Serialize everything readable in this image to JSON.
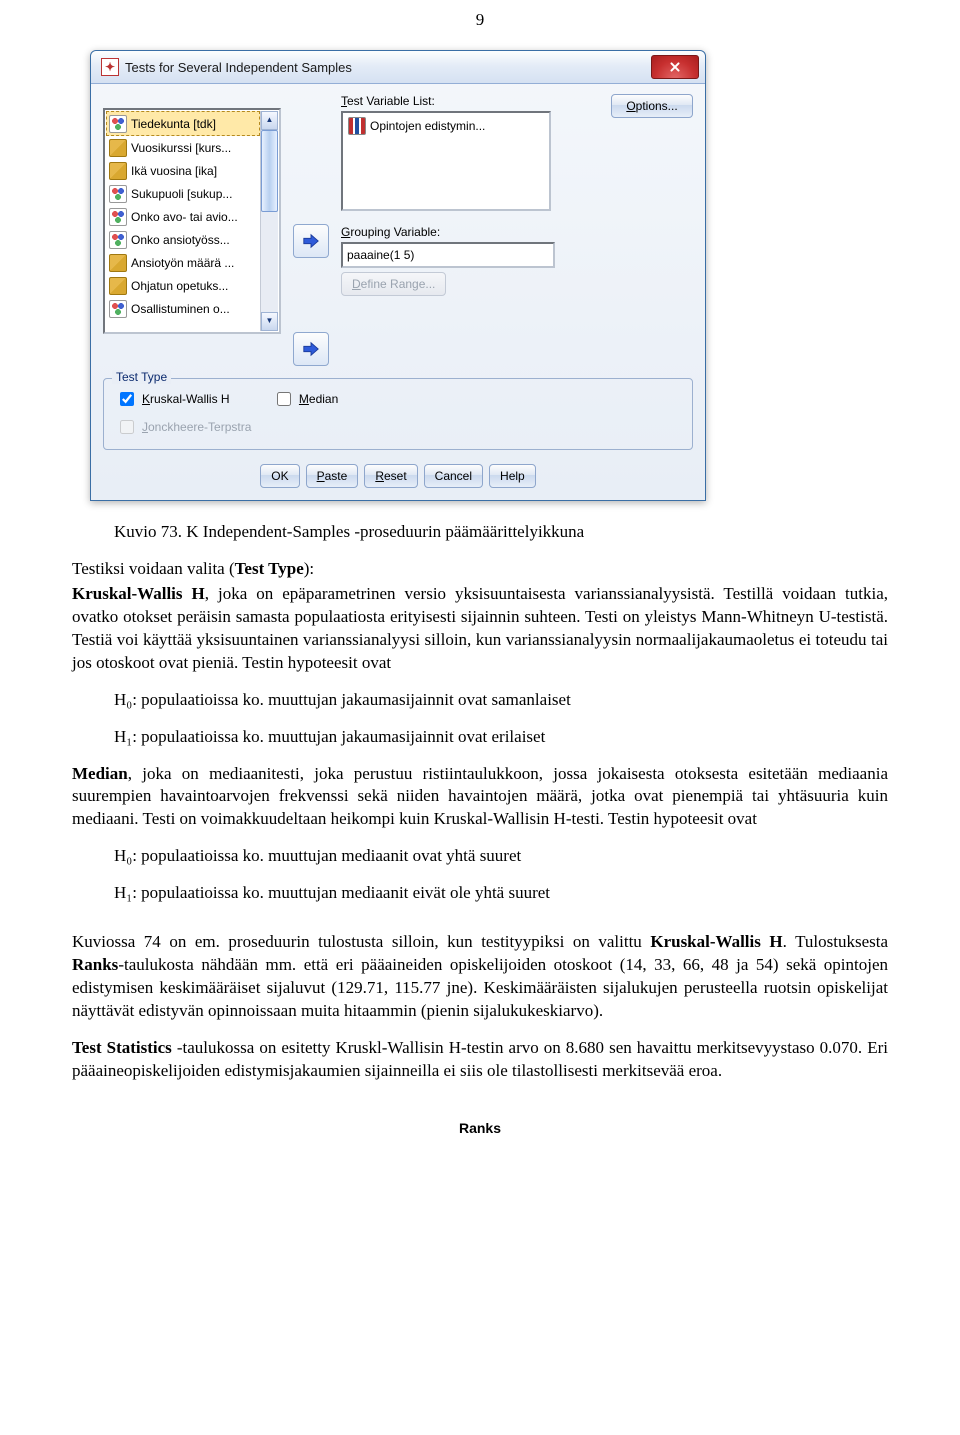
{
  "page_number": "9",
  "dialog": {
    "title": "Tests for Several Independent Samples",
    "source_items": [
      {
        "icon": "nom",
        "text": "Tiedekunta [tdk]",
        "selected": true
      },
      {
        "icon": "scale",
        "text": "Vuosikurssi [kurs..."
      },
      {
        "icon": "scale",
        "text": "Ikä vuosina [ika]"
      },
      {
        "icon": "nom",
        "text": "Sukupuoli [sukup..."
      },
      {
        "icon": "nom",
        "text": "Onko avo- tai avio..."
      },
      {
        "icon": "nom",
        "text": "Onko ansiotyöss..."
      },
      {
        "icon": "scale",
        "text": "Ansiotyön määrä ..."
      },
      {
        "icon": "scale",
        "text": "Ohjatun opetuks..."
      },
      {
        "icon": "nom",
        "text": "Osallistuminen o..."
      }
    ],
    "tvl_label": "Test Variable List:",
    "tvl_item": "Opintojen edistymin...",
    "gv_label": "Grouping Variable:",
    "gv_value": "paaaine(1 5)",
    "define": "Define Range...",
    "options": "Options...",
    "testtype_legend": "Test Type",
    "kw": "Kruskal-Wallis H",
    "median": "Median",
    "jt": "Jonckheere-Terpstra",
    "buttons": {
      "ok": "OK",
      "paste": "Paste",
      "reset": "Reset",
      "cancel": "Cancel",
      "help": "Help"
    }
  },
  "caption": "Kuvio 73. K Independent-Samples -proseduurin päämäärittelyikkuna",
  "p1a": "Testiksi voidaan valita (",
  "p1b": "Test Type",
  "p1c": "):",
  "kw_para_a": "Kruskal-Wallis H",
  "kw_para_b": ", joka on epäparametrinen versio yksisuuntaisesta varianssianalyysistä. Testillä voidaan tutkia, ovatko otokset peräisin samasta populaatiosta erityisesti sijainnin suhteen. Testi on yleistys Mann-Whitneyn U-testistä. Testiä voi käyttää yksisuuntainen varianssianalyysi  silloin, kun varianssianalyysin normaalijakaumaoletus ei toteudu tai jos otoskoot ovat pieniä. Testin hypoteesit ovat",
  "h0a": "H₀: populaatioissa ko. muuttujan jakaumasijainnit ovat samanlaiset",
  "h1a": "H₁: populaatioissa ko. muuttujan jakaumasijainnit ovat erilaiset",
  "median_para_a": "Median",
  "median_para_b": ", joka on mediaanitesti, joka perustuu ristiintaulukkoon, jossa jokaisesta otoksesta esitetään mediaania suurempien havaintoarvojen frekvenssi sekä niiden havaintojen määrä, jotka ovat pienempiä tai yhtäsuuria kuin mediaani. Testi on voimakkuudeltaan heikompi kuin Kruskal-Wallisin H-testi. Testin hypoteesit ovat",
  "h0b": "H₀: populaatioissa ko. muuttujan mediaanit ovat yhtä suuret",
  "h1b": "H₁: populaatioissa ko. muuttujan mediaanit eivät ole yhtä suuret",
  "p2a": "Kuviossa 74 on em. proseduurin tulostusta silloin, kun testityypiksi on valittu ",
  "p2b": "Kruskal-Wallis H",
  "p2c": ". Tulostuksesta ",
  "p2d": "Ranks",
  "p2e": "-taulukosta nähdään mm. että eri pääaineiden opiskelijoiden otoskoot (14, 33, 66, 48 ja 54) sekä opintojen edistymisen keskimääräiset sijaluvut (129.71, 115.77 jne). Keskimääräisten sijalukujen perusteella ruotsin opiskelijat näyttävät edistyvän opinnoissaan muita hitaammin (pienin sijalukukeskiarvo).",
  "p3a": "Test Statistics ",
  "p3b": "-taulukossa on esitetty Kruskl-Wallisin H-testin arvo on 8.680 sen havaittu merkitsevyystaso 0.070. Eri pääaineopiskelijoiden edistymisjakaumien sijainneilla ei siis ole tilastollisesti merkitsevää eroa.",
  "ranks": "Ranks"
}
